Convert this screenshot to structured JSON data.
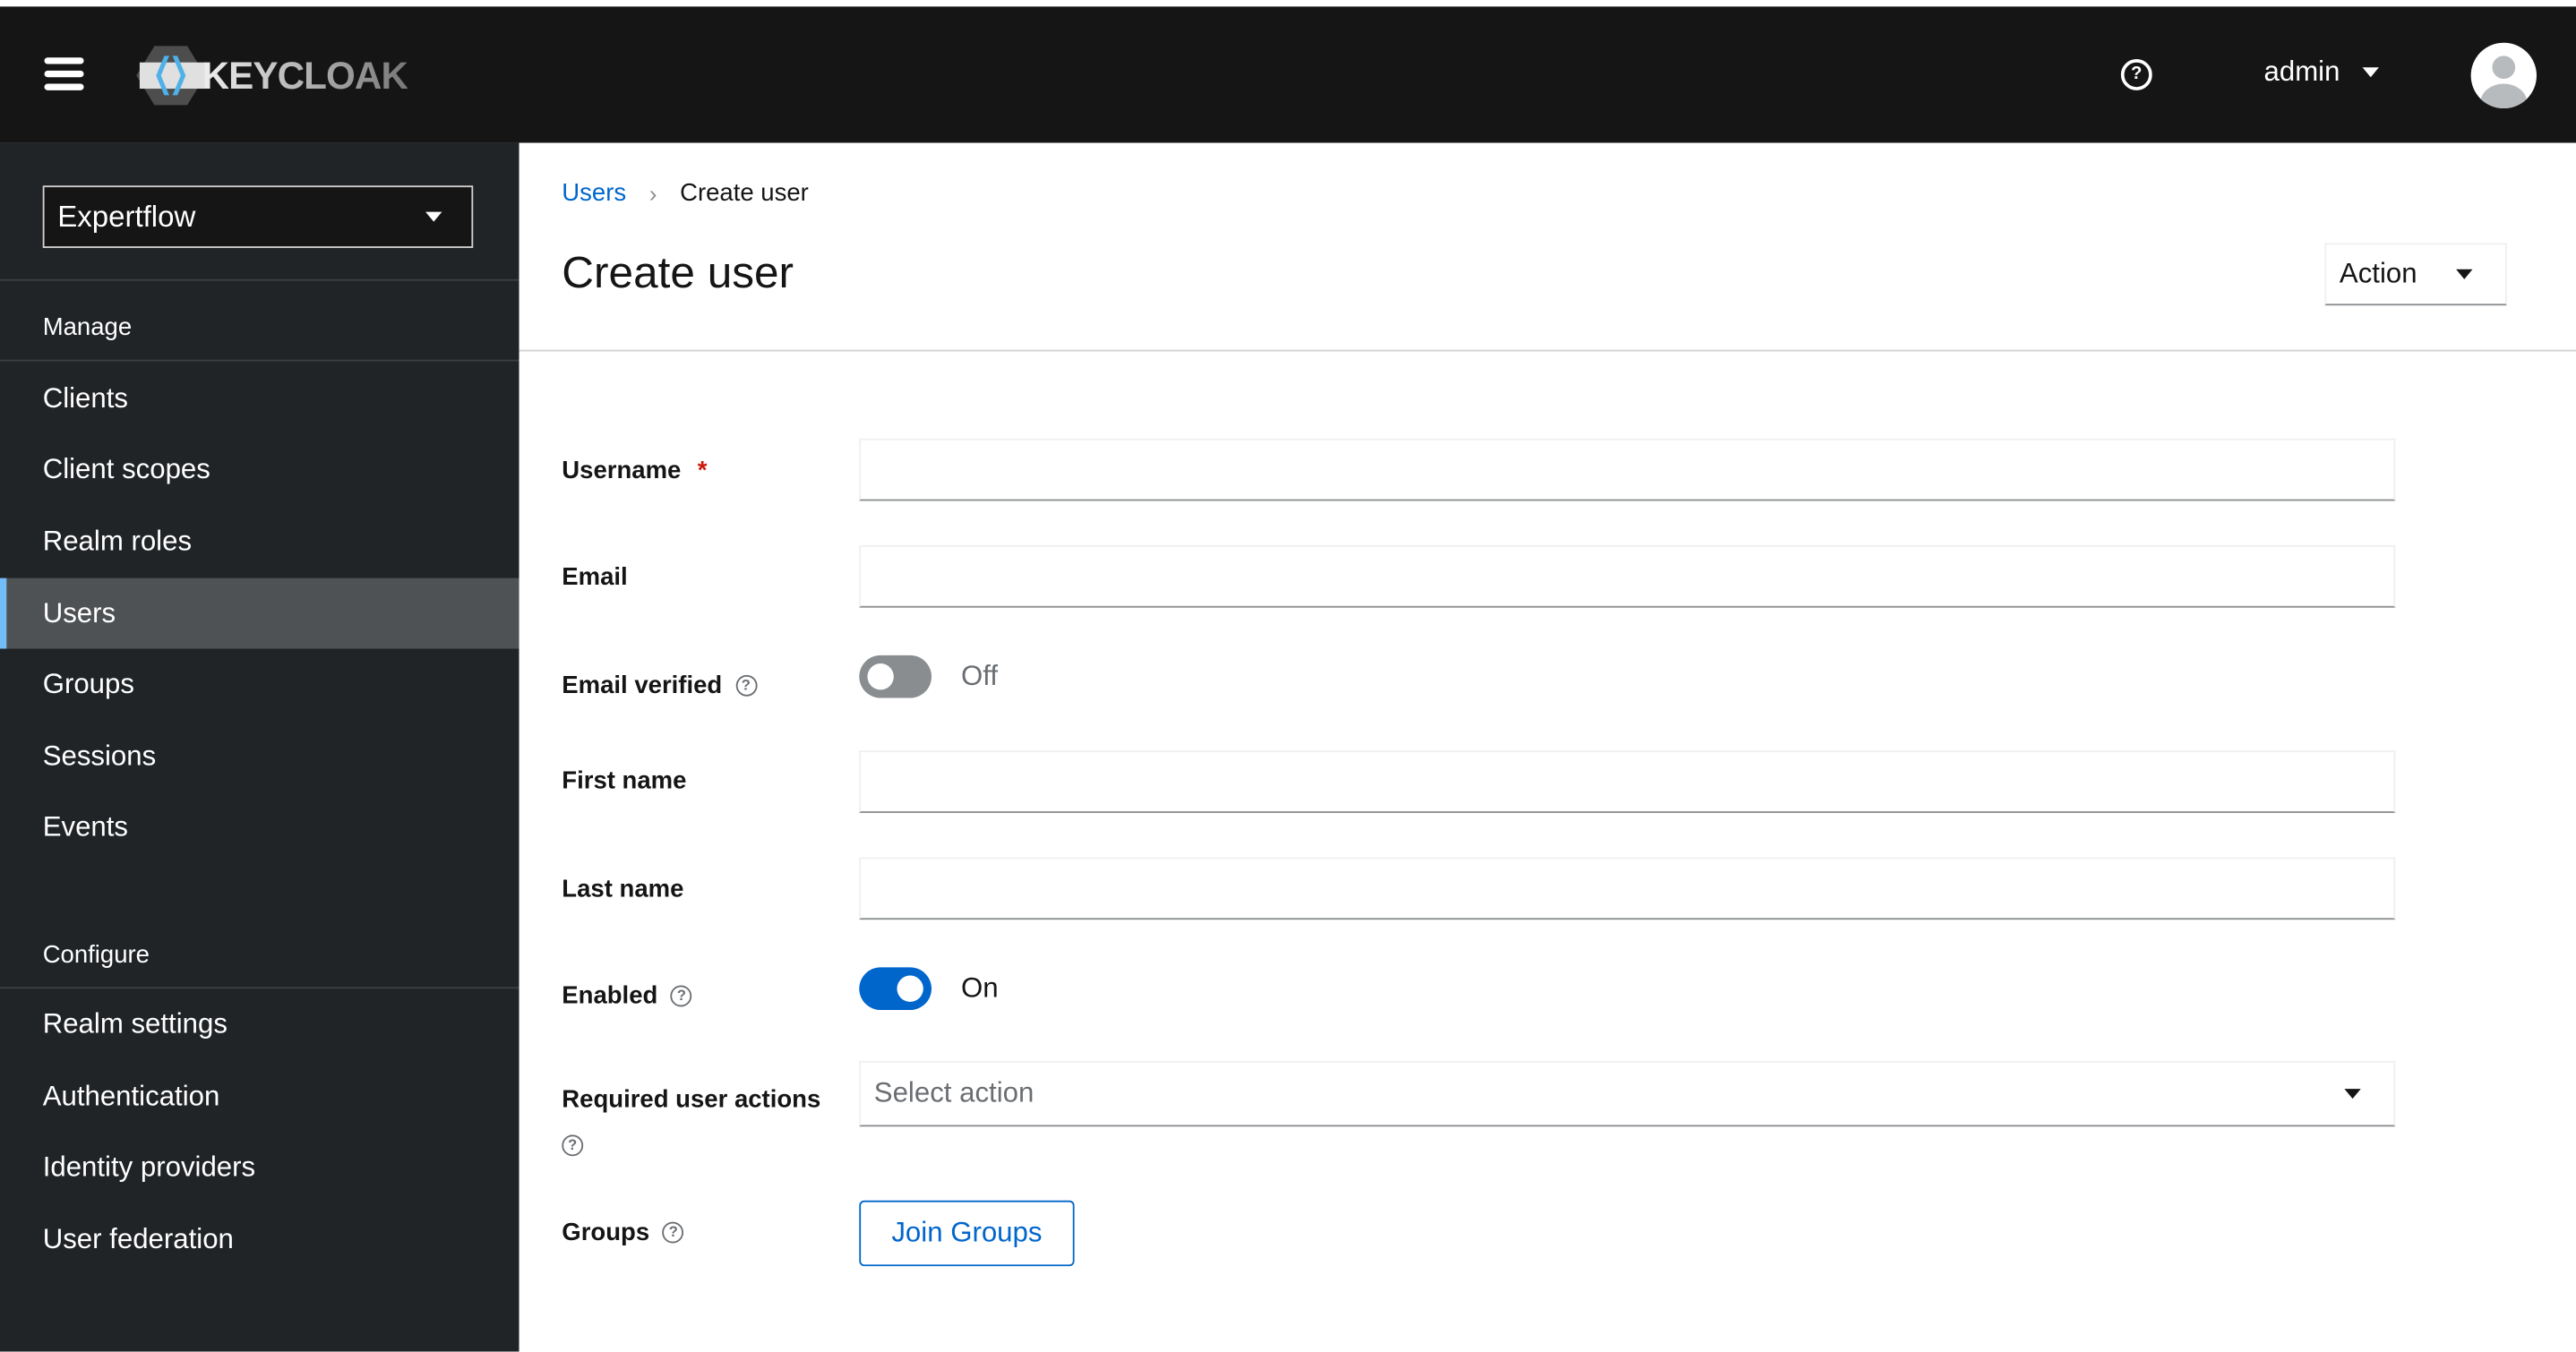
{
  "header": {
    "logo_text": "KEYCLOAK",
    "username": "admin",
    "help_icon": "help-icon",
    "avatar_icon": "avatar"
  },
  "sidebar": {
    "realm": "Expertflow",
    "manage_heading": "Manage",
    "manage_items": [
      "Clients",
      "Client scopes",
      "Realm roles",
      "Users",
      "Groups",
      "Sessions",
      "Events"
    ],
    "configure_heading": "Configure",
    "configure_items": [
      "Realm settings",
      "Authentication",
      "Identity providers",
      "User federation"
    ],
    "active_item": "Users"
  },
  "main": {
    "breadcrumb": {
      "parent": "Users",
      "current": "Create user"
    },
    "title": "Create user",
    "action_label": "Action",
    "form": {
      "username_label": "Username",
      "required_mark": "*",
      "email_label": "Email",
      "email_verified_label": "Email verified",
      "email_verified_state": "Off",
      "first_name_label": "First name",
      "last_name_label": "Last name",
      "enabled_label": "Enabled",
      "enabled_state": "On",
      "required_actions_label": "Required user actions",
      "required_actions_placeholder": "Select action",
      "groups_label": "Groups",
      "join_groups_label": "Join Groups"
    }
  },
  "colors": {
    "accent": "#0066cc",
    "toggle_on": "#0066cc",
    "toggle_off": "#8a8d90",
    "header_bg": "#151515",
    "sidebar_bg": "#212427"
  }
}
